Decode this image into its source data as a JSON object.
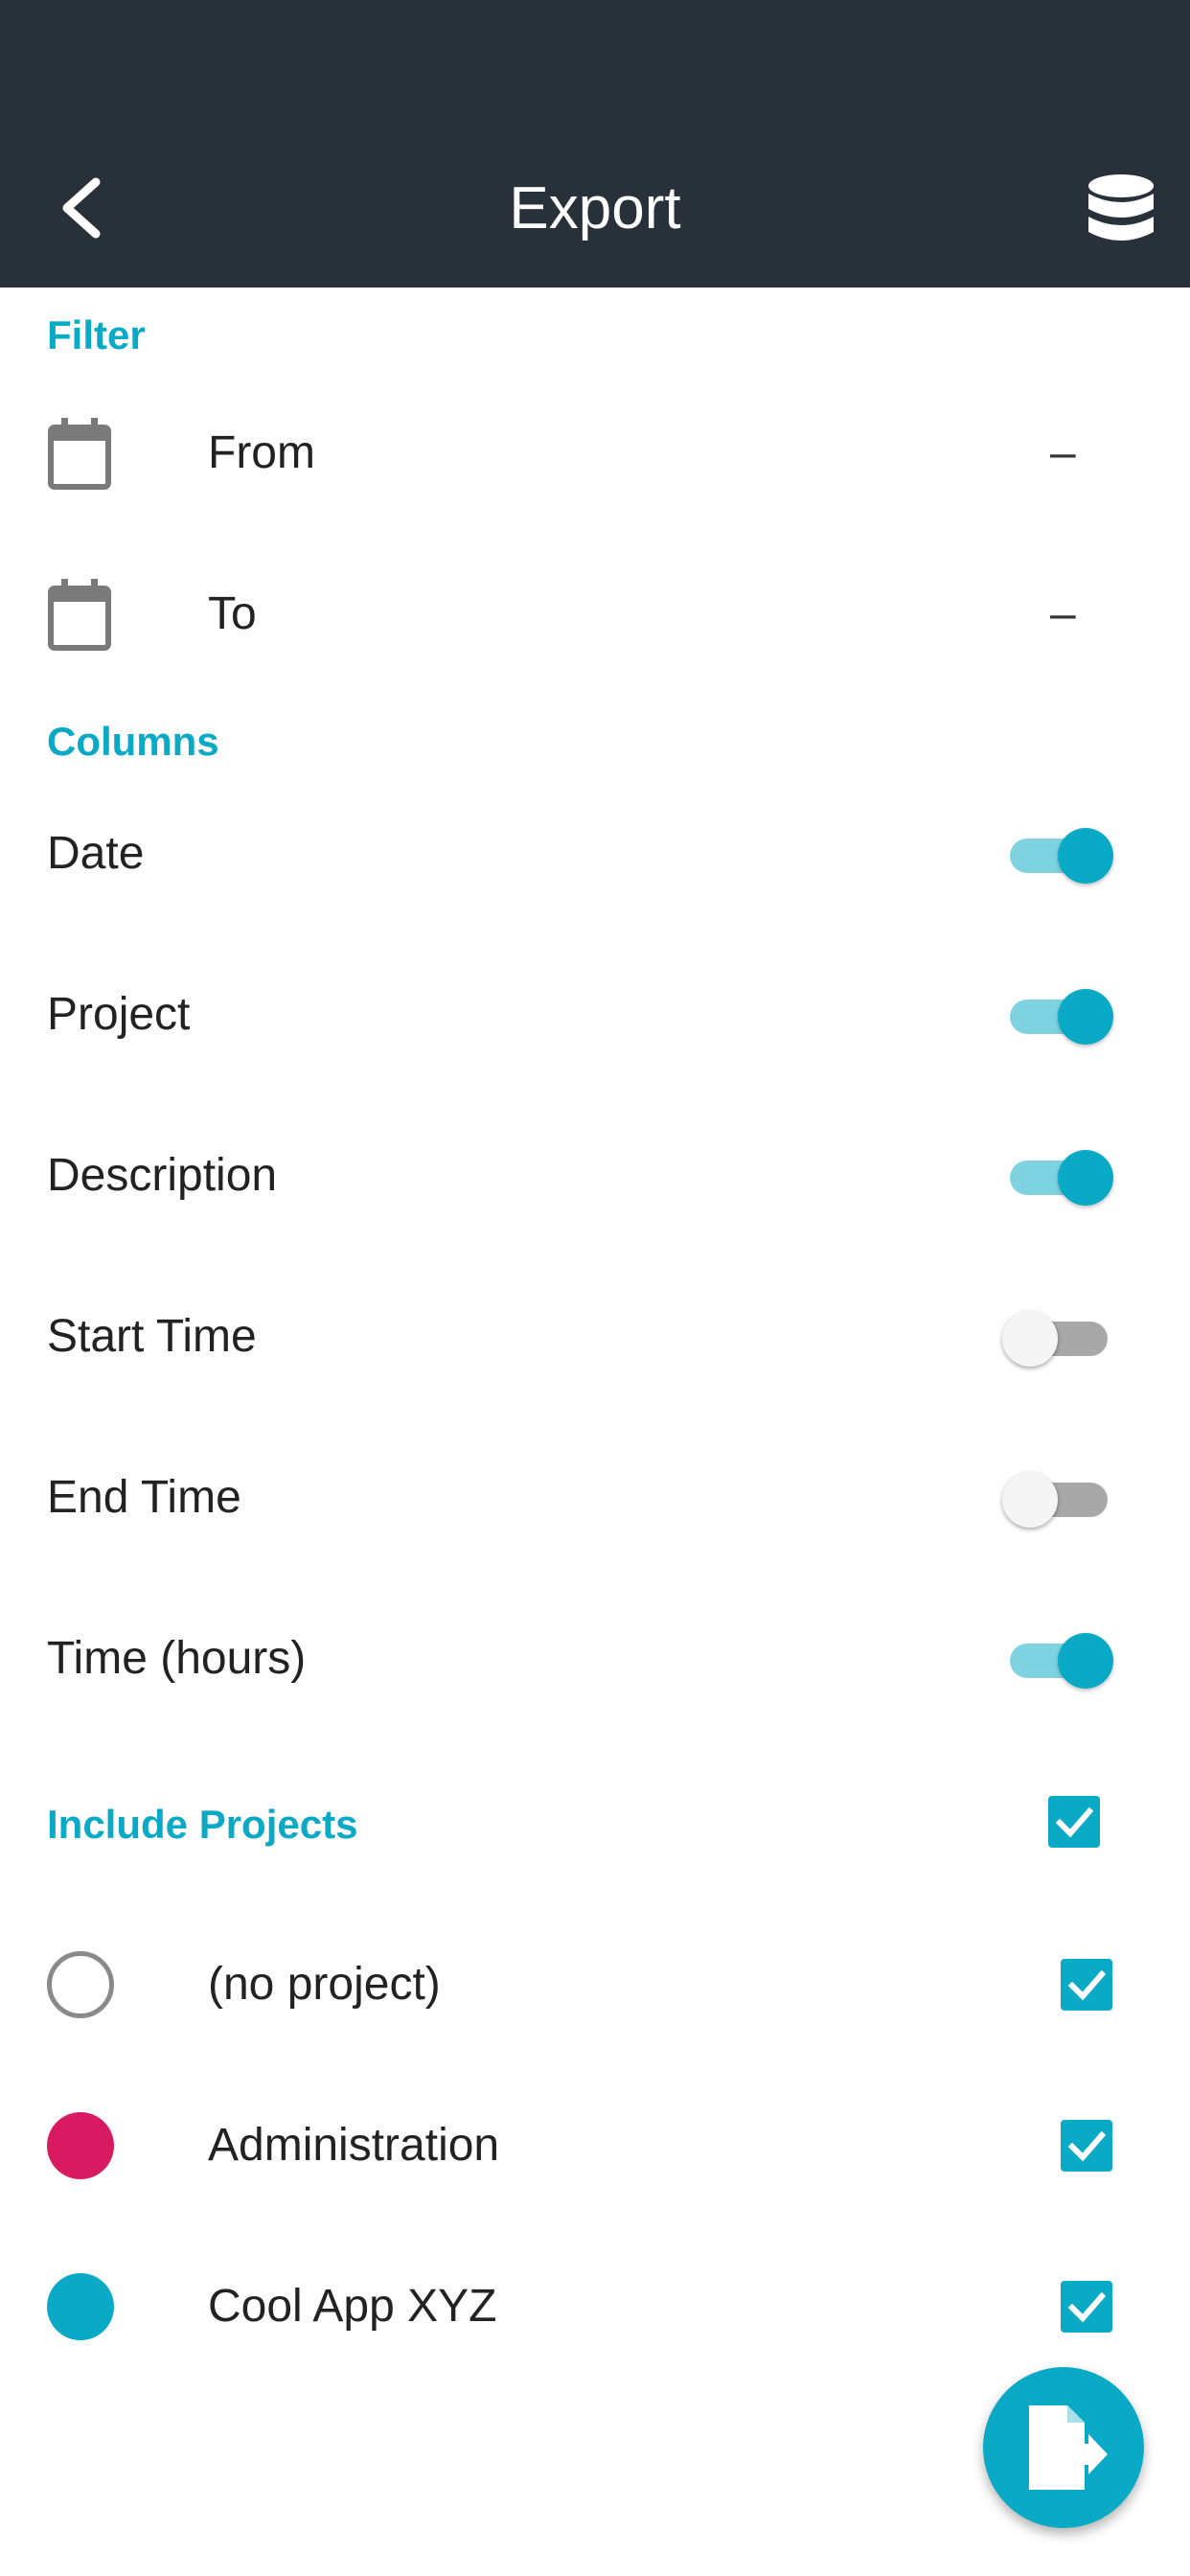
{
  "appbar": {
    "title": "Export",
    "back_icon": "chevron-left-icon",
    "action_icon": "database-icon"
  },
  "filter": {
    "section_label": "Filter",
    "from_label": "From",
    "from_value": "–",
    "to_label": "To",
    "to_value": "–",
    "icon": "calendar-icon"
  },
  "columns": {
    "section_label": "Columns",
    "items": [
      {
        "label": "Date",
        "enabled": true
      },
      {
        "label": "Project",
        "enabled": true
      },
      {
        "label": "Description",
        "enabled": true
      },
      {
        "label": "Start Time",
        "enabled": false
      },
      {
        "label": "End Time",
        "enabled": false
      },
      {
        "label": "Time (hours)",
        "enabled": true
      }
    ]
  },
  "projects": {
    "section_label": "Include Projects",
    "all_checked": true,
    "items": [
      {
        "label": "(no project)",
        "color": "",
        "checked": true
      },
      {
        "label": "Administration",
        "color": "#d81b60",
        "checked": true
      },
      {
        "label": "Cool App XYZ",
        "color": "#0aa9c6",
        "checked": true
      }
    ]
  },
  "fab": {
    "icon": "export-file-icon"
  },
  "colors": {
    "appbar": "#283139",
    "accent": "#0aa9c6",
    "toggle_track_on": "#7fd3e1",
    "toggle_track_off": "#a8a8a8"
  }
}
